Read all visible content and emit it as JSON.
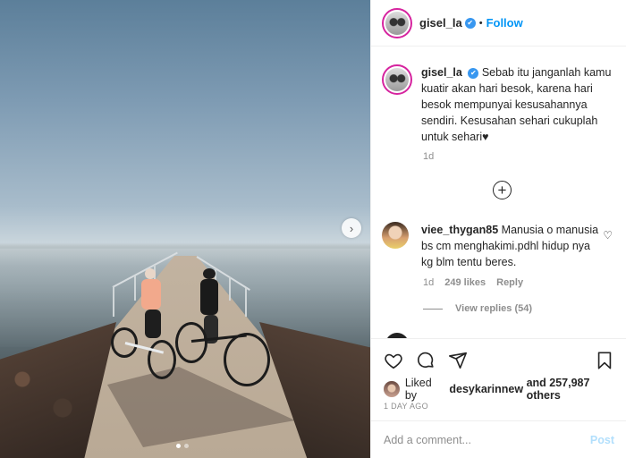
{
  "post": {
    "username": "gisel_la",
    "follow_label": "Follow",
    "separator": "•",
    "caption_username": "gisel_la",
    "caption_text": "Sebab itu janganlah kamu kuatir akan hari besok, karena hari besok mempunyai kesusahannya sendiri. Kesusahan sehari cukuplah untuk sehari♥",
    "caption_time": "1d",
    "likes_user": "desykarinnew",
    "likes_text": "and 257,987 others",
    "likes_prefix": "Liked by",
    "date": "1 DAY AGO"
  },
  "comment": {
    "username": "viee_thygan85",
    "text": "Manusia o manusia bs cm menghakimi.pdhl hidup nya kg blm tentu beres.",
    "time": "1d",
    "likes": "249 likes",
    "reply_label": "Reply",
    "view_replies": "View replies (54)"
  },
  "add_comment": {
    "placeholder": "Add a comment...",
    "post_label": "Post"
  },
  "carousel": {
    "current": 1,
    "total": 2,
    "next_icon": "chevron-right-icon"
  },
  "icons": [
    "verified-icon",
    "add-circle-icon",
    "heart-icon",
    "comment-icon",
    "share-icon",
    "bookmark-icon"
  ],
  "colors": {
    "link": "#0095f6",
    "verified": "#3897f0",
    "muted": "#8e8e8e",
    "post_disabled": "#b2dffc"
  }
}
